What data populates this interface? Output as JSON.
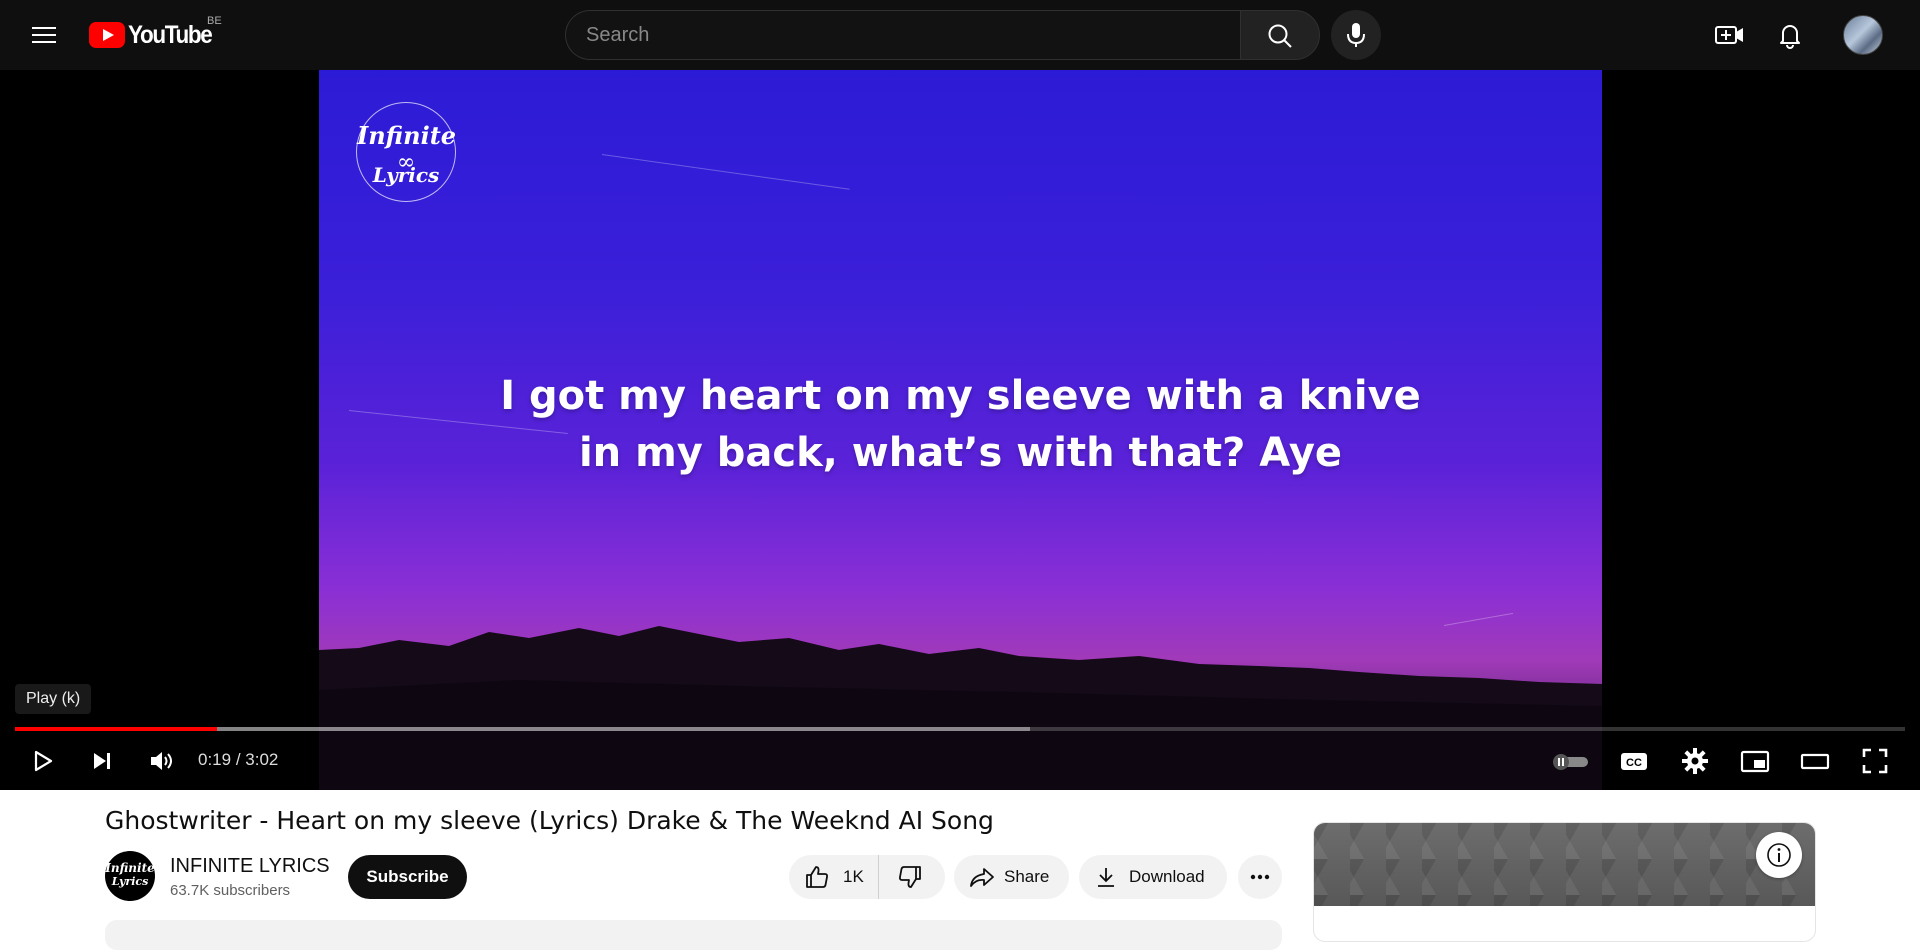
{
  "masthead": {
    "logo_text": "YouTube",
    "country_code": "BE",
    "search_placeholder": "Search",
    "icons": [
      "menu-icon",
      "search-icon",
      "microphone-icon",
      "create-video-icon",
      "notifications-bell-icon",
      "account-avatar"
    ]
  },
  "player": {
    "channel_logo": {
      "line1": "Infinite",
      "line2": "Lyrics"
    },
    "lyric_line1": "I got my heart on my sleeve with a knive",
    "lyric_line2": "in my back, what’s with that? Aye",
    "tooltip": "Play (k)",
    "current_time": "0:19",
    "duration": "3:02",
    "time_separator": " / ",
    "progress_played_fraction": 0.107,
    "progress_buffered_fraction": 0.537,
    "controls": [
      "play-icon",
      "next-icon",
      "volume-icon",
      "autoplay-toggle",
      "captions-icon",
      "settings-gear-icon",
      "miniplayer-icon",
      "theater-mode-icon",
      "fullscreen-icon"
    ],
    "colors": {
      "progress": "#ff0000",
      "sky_top": "#2c1bd6",
      "sky_bottom": "#a13ab8"
    }
  },
  "video": {
    "title": "Ghostwriter - Heart on my sleeve (Lyrics) Drake & The Weeknd AI Song",
    "channel_name": "INFINITE LYRICS",
    "subscribers": "63.7K subscribers",
    "subscribe_label": "Subscribe",
    "likes": "1K",
    "share_label": "Share",
    "download_label": "Download"
  },
  "owner_avatar": {
    "line1": "Infinite",
    "line2": "Lyrics"
  }
}
